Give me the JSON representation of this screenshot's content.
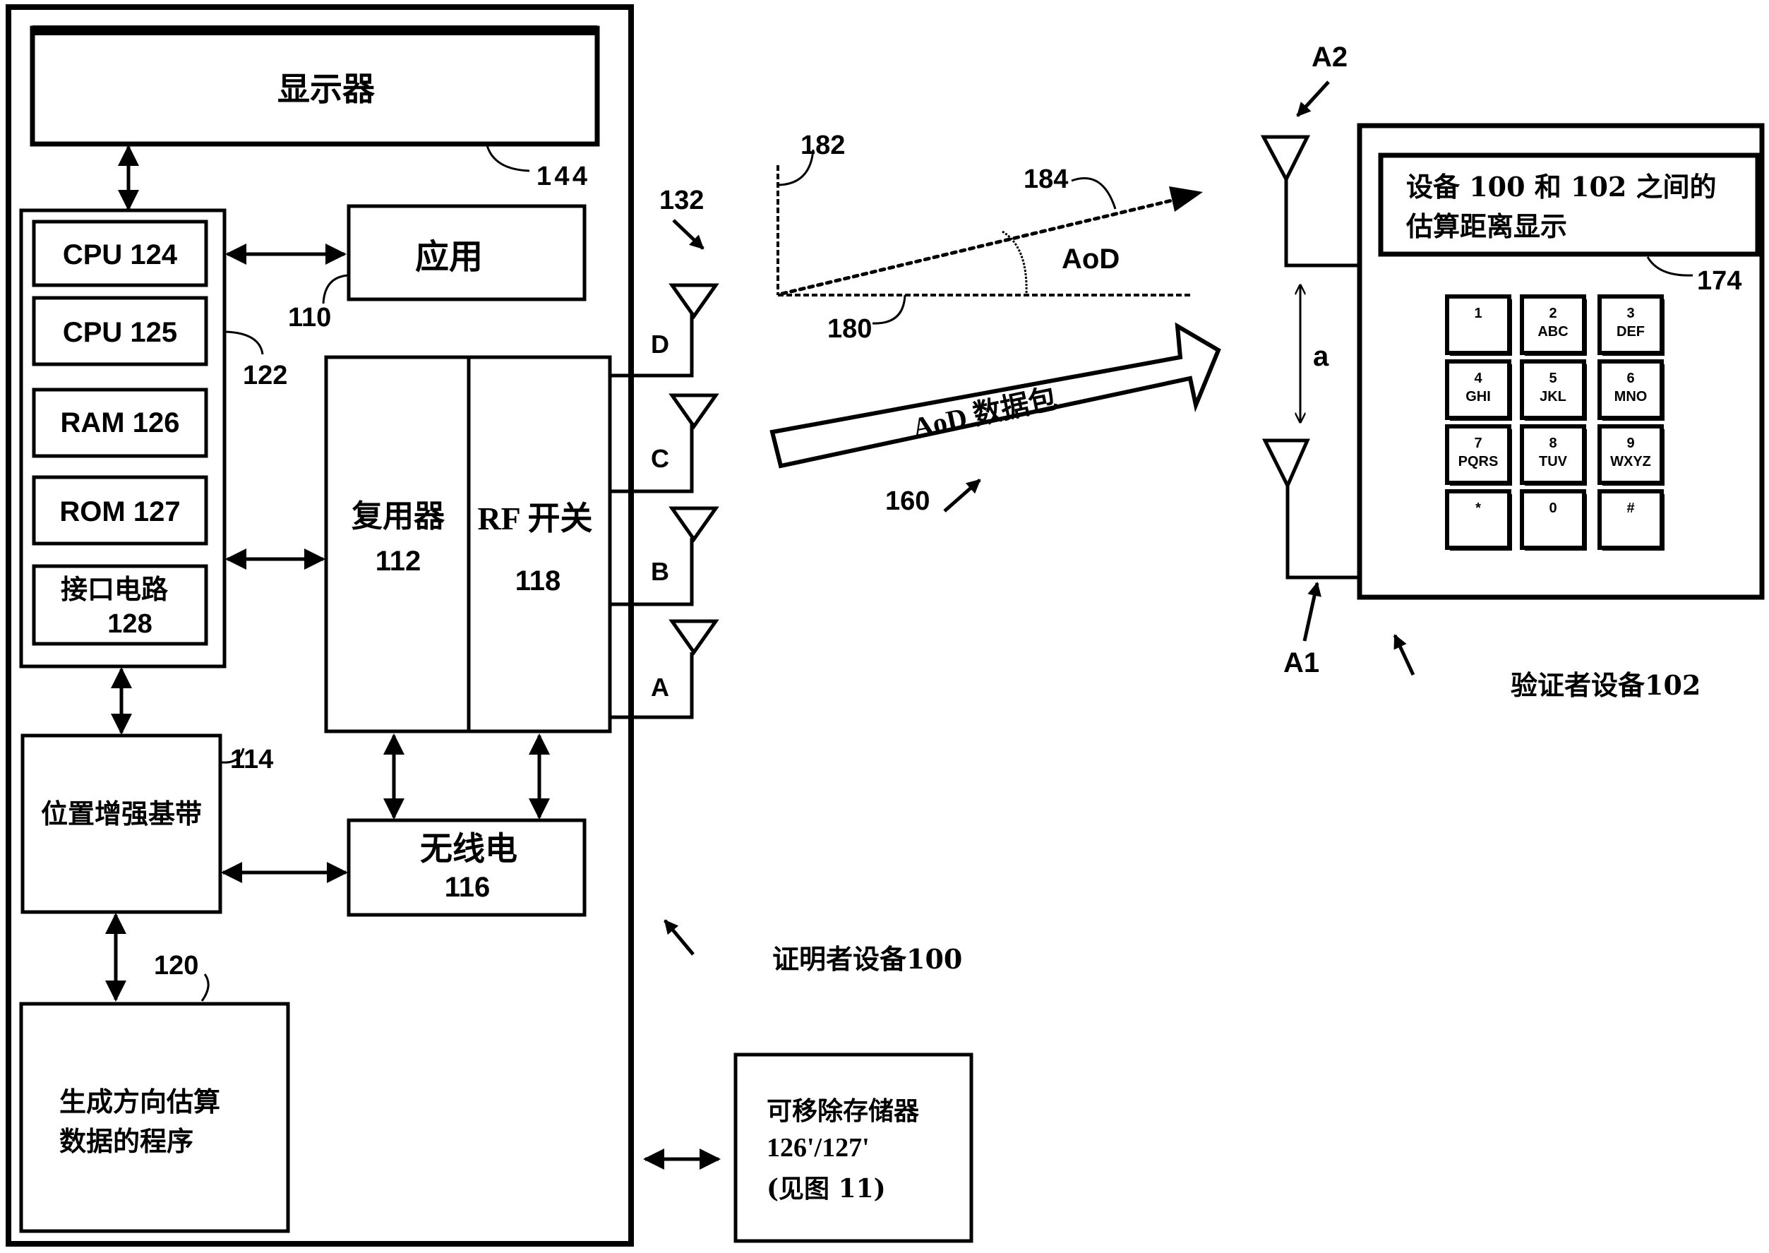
{
  "prover": {
    "device_label": "证明者设备100",
    "display": {
      "label": "显示器",
      "ref": "144"
    },
    "application": {
      "label": "应用",
      "ref": "110"
    },
    "processor_group_ref": "122",
    "components": [
      {
        "label": "CPU 124"
      },
      {
        "label": "CPU 125"
      },
      {
        "label": "RAM 126"
      },
      {
        "label": "ROM 127"
      },
      {
        "label": "接口电路",
        "sub": "128"
      }
    ],
    "multiplexer": {
      "label": "复用器",
      "ref": "112"
    },
    "rf_switch": {
      "label": "RF 开关",
      "ref": "118"
    },
    "baseband": {
      "label": "位置增强基带",
      "ref": "114"
    },
    "radio": {
      "label": "无线电",
      "ref": "116"
    },
    "program": {
      "line1": "生成方向估算",
      "line2": "数据的程序",
      "ref": "120"
    },
    "antenna_array_ref": "132",
    "antennas": [
      "D",
      "C",
      "B",
      "A"
    ]
  },
  "removable_storage": {
    "line1": "可移除存储器",
    "line2": "126'/127'",
    "line3": "(见图 11)"
  },
  "aod": {
    "vertical_ref": "182",
    "baseline_ref": "180",
    "direction_ref": "184",
    "angle_label": "AoD",
    "packet_label": "AoD 数据包",
    "packet_ref": "160"
  },
  "verifier": {
    "device_label": "验证者设备102",
    "antenna_top": "A2",
    "antenna_bottom": "A1",
    "spacing_label": "a",
    "screen": {
      "line1": "设备 100 和 102 之间的",
      "line2": "估算距离显示",
      "ref": "174"
    },
    "keypad": [
      {
        "digit": "1",
        "letters": ""
      },
      {
        "digit": "2",
        "letters": "ABC"
      },
      {
        "digit": "3",
        "letters": "DEF"
      },
      {
        "digit": "4",
        "letters": "GHI"
      },
      {
        "digit": "5",
        "letters": "JKL"
      },
      {
        "digit": "6",
        "letters": "MNO"
      },
      {
        "digit": "7",
        "letters": "PQRS"
      },
      {
        "digit": "8",
        "letters": "TUV"
      },
      {
        "digit": "9",
        "letters": "WXYZ"
      },
      {
        "digit": "*",
        "letters": ""
      },
      {
        "digit": "0",
        "letters": ""
      },
      {
        "digit": "#",
        "letters": ""
      }
    ]
  }
}
